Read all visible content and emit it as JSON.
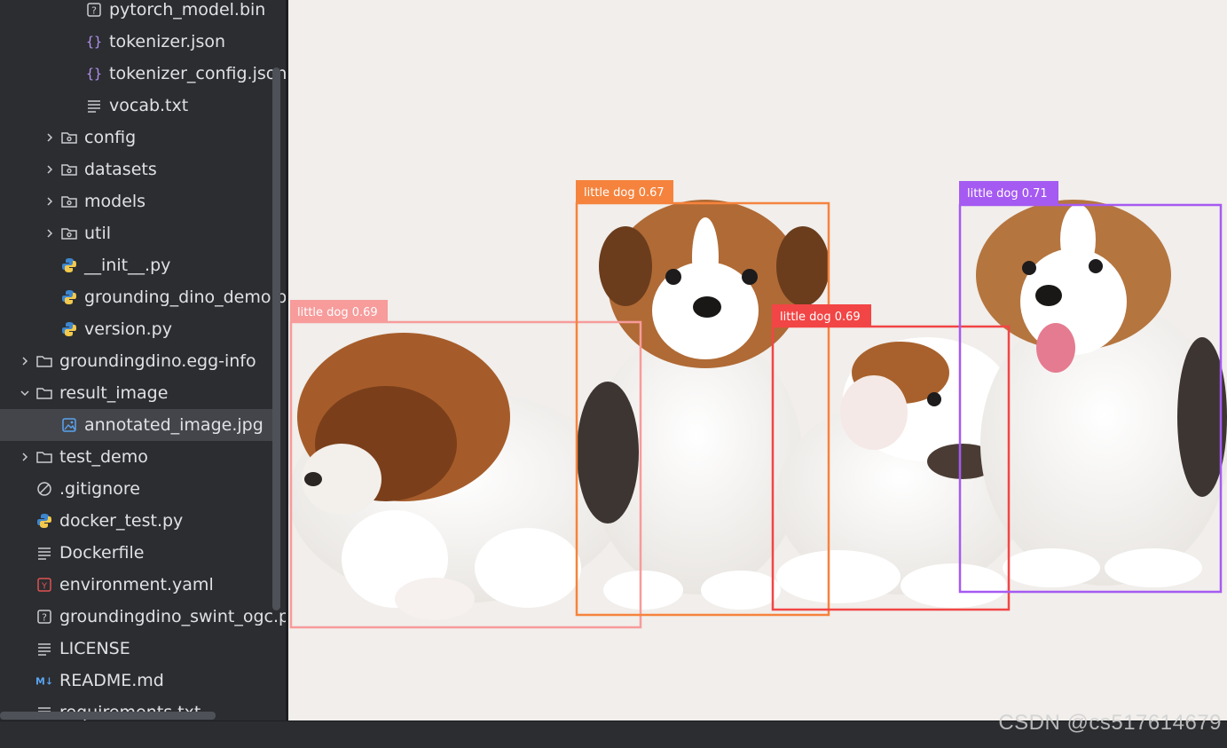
{
  "tree": [
    {
      "label": "pytorch_model.bin",
      "icon": "unknown-file-icon",
      "depth": 3,
      "expandable": false,
      "selected": false
    },
    {
      "label": "tokenizer.json",
      "icon": "json-file-icon",
      "depth": 3,
      "expandable": false,
      "selected": false
    },
    {
      "label": "tokenizer_config.json",
      "icon": "json-file-icon",
      "depth": 3,
      "expandable": false,
      "selected": false
    },
    {
      "label": "vocab.txt",
      "icon": "text-file-icon",
      "depth": 3,
      "expandable": false,
      "selected": false
    },
    {
      "label": "config",
      "icon": "package-folder-icon",
      "depth": 2,
      "expandable": true,
      "expanded": false,
      "selected": false
    },
    {
      "label": "datasets",
      "icon": "package-folder-icon",
      "depth": 2,
      "expandable": true,
      "expanded": false,
      "selected": false
    },
    {
      "label": "models",
      "icon": "package-folder-icon",
      "depth": 2,
      "expandable": true,
      "expanded": false,
      "selected": false
    },
    {
      "label": "util",
      "icon": "package-folder-icon",
      "depth": 2,
      "expandable": true,
      "expanded": false,
      "selected": false
    },
    {
      "label": "__init__.py",
      "icon": "python-file-icon",
      "depth": 2,
      "expandable": false,
      "selected": false
    },
    {
      "label": "grounding_dino_demo.py",
      "icon": "python-file-icon",
      "depth": 2,
      "expandable": false,
      "selected": false
    },
    {
      "label": "version.py",
      "icon": "python-file-icon",
      "depth": 2,
      "expandable": false,
      "selected": false
    },
    {
      "label": "groundingdino.egg-info",
      "icon": "folder-icon",
      "depth": 1,
      "expandable": true,
      "expanded": false,
      "selected": false
    },
    {
      "label": "result_image",
      "icon": "folder-icon",
      "depth": 1,
      "expandable": true,
      "expanded": true,
      "selected": false
    },
    {
      "label": "annotated_image.jpg",
      "icon": "image-file-icon",
      "depth": 2,
      "expandable": false,
      "selected": true
    },
    {
      "label": "test_demo",
      "icon": "folder-icon",
      "depth": 1,
      "expandable": true,
      "expanded": false,
      "selected": false
    },
    {
      "label": ".gitignore",
      "icon": "ignore-file-icon",
      "depth": 1,
      "expandable": false,
      "selected": false
    },
    {
      "label": "docker_test.py",
      "icon": "python-file-icon",
      "depth": 1,
      "expandable": false,
      "selected": false
    },
    {
      "label": "Dockerfile",
      "icon": "text-file-icon",
      "depth": 1,
      "expandable": false,
      "selected": false
    },
    {
      "label": "environment.yaml",
      "icon": "yaml-file-icon",
      "depth": 1,
      "expandable": false,
      "selected": false
    },
    {
      "label": "groundingdino_swint_ogc.pth",
      "icon": "unknown-file-icon",
      "depth": 1,
      "expandable": false,
      "selected": false
    },
    {
      "label": "LICENSE",
      "icon": "text-file-icon",
      "depth": 1,
      "expandable": false,
      "selected": false
    },
    {
      "label": "README.md",
      "icon": "markdown-file-icon",
      "depth": 1,
      "expandable": false,
      "selected": false
    },
    {
      "label": "requirements.txt",
      "icon": "text-file-icon",
      "depth": 1,
      "expandable": false,
      "selected": false
    }
  ],
  "detections": [
    {
      "label": "little dog 0.69",
      "color": "#f79b9b"
    },
    {
      "label": "little dog 0.67",
      "color": "#f5833d"
    },
    {
      "label": "little dog 0.69",
      "color": "#f24545"
    },
    {
      "label": "little dog 0.71",
      "color": "#a55af2"
    }
  ],
  "watermark": "CSDN @cs517614679"
}
